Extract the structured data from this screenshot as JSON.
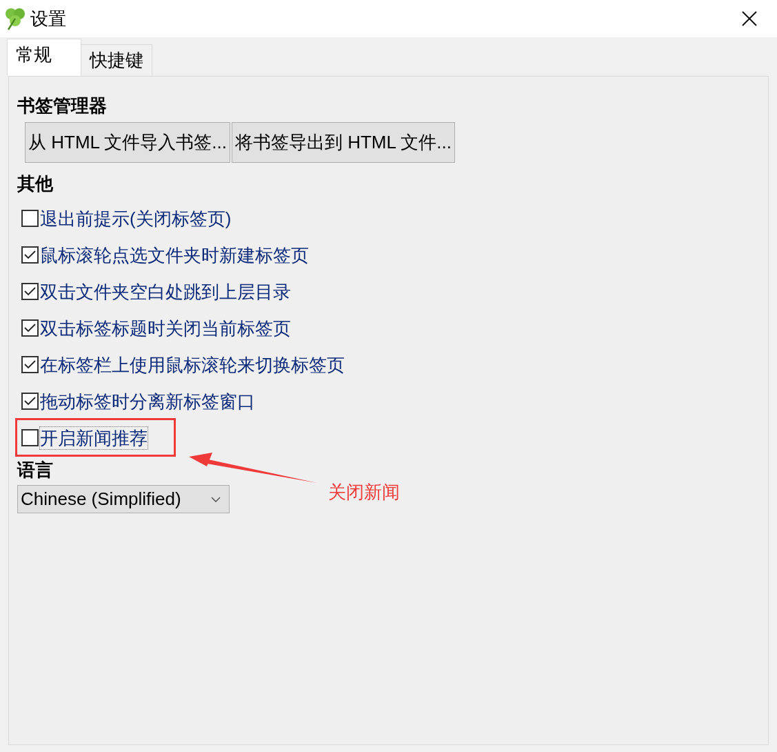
{
  "window": {
    "title": "设置"
  },
  "tabs": [
    {
      "label": "常规",
      "selected": true
    },
    {
      "label": "快捷键",
      "selected": false
    }
  ],
  "bookmark_section": {
    "title": "书签管理器",
    "buttons": [
      "从 HTML 文件导入书签...",
      "将书签导出到 HTML 文件..."
    ]
  },
  "other_section": {
    "title": "其他",
    "options": [
      {
        "label": "退出前提示(关闭标签页)",
        "checked": false,
        "focused": false
      },
      {
        "label": "鼠标滚轮点选文件夹时新建标签页",
        "checked": true,
        "focused": false
      },
      {
        "label": "双击文件夹空白处跳到上层目录",
        "checked": true,
        "focused": false
      },
      {
        "label": "双击标签标题时关闭当前标签页",
        "checked": true,
        "focused": false
      },
      {
        "label": "在标签栏上使用鼠标滚轮来切换标签页",
        "checked": true,
        "focused": false
      },
      {
        "label": "拖动标签时分离新标签窗口",
        "checked": true,
        "focused": false
      },
      {
        "label": "开启新闻推荐",
        "checked": false,
        "focused": true
      }
    ]
  },
  "language_section": {
    "title": "语言",
    "value": "Chinese (Simplified)"
  },
  "annotation": {
    "text": "关闭新闻"
  }
}
